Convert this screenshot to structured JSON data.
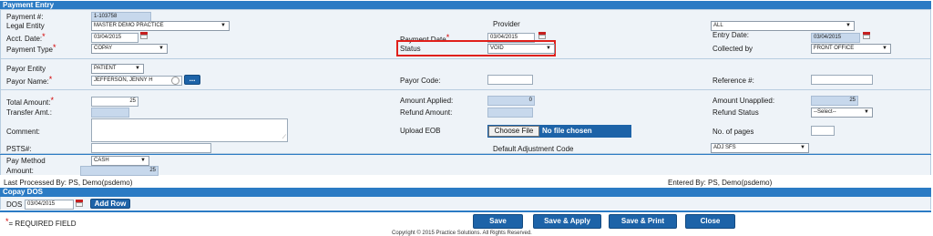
{
  "payment_entry": {
    "section_title": "Payment Entry",
    "payment_number_label": "Payment #:",
    "payment_number_value": "1-103758",
    "legal_entity_label": "Legal Entity",
    "legal_entity_value": "MASTER DEMO PRACTICE",
    "provider_label": "Provider",
    "provider_value": "ALL",
    "acct_date_label": "Acct. Date:",
    "acct_date_value": "03/04/2015",
    "payment_date_label": "Payment Date",
    "payment_date_value": "03/04/2015",
    "entry_date_label": "Entry Date:",
    "entry_date_value": "03/04/2015",
    "payment_type_label": "Payment Type",
    "payment_type_value": "COPAY",
    "status_label": "Status",
    "status_value": "VOID",
    "collected_by_label": "Collected by",
    "collected_by_value": "FRONT OFFICE",
    "payor_entity_label": "Payor Entity",
    "payor_entity_value": "PATIENT",
    "payor_name_label": "Payor Name:",
    "payor_name_value": "JEFFERSON, JENNY H",
    "payor_search_button": "...",
    "payor_code_label": "Payor Code:",
    "payor_code_value": "",
    "reference_label": "Reference #:",
    "reference_value": "",
    "total_amount_label": "Total Amount:",
    "total_amount_value": "25",
    "amount_applied_label": "Amount Applied:",
    "amount_applied_value": "0",
    "amount_unapplied_label": "Amount Unapplied:",
    "amount_unapplied_value": "25",
    "transfer_amt_label": "Transfer Amt.:",
    "transfer_amt_value": "",
    "refund_amount_label": "Refund Amount:",
    "refund_amount_value": "",
    "refund_status_label": "Refund Status",
    "refund_status_value": "--Select--",
    "comment_label": "Comment:",
    "comment_value": "",
    "upload_eob_label": "Upload EOB",
    "choose_file_button": "Choose File",
    "no_file_text": "No file chosen",
    "no_of_pages_label": "No. of pages",
    "no_of_pages_value": "",
    "psts_label": "PSTS#:",
    "psts_value": "",
    "default_adjustment_label": "Default Adjustment Code",
    "default_adjustment_value": "ADJ SFS"
  },
  "pay_method": {
    "pay_method_label": "Pay Method",
    "pay_method_value": "CASH",
    "amount_label": "Amount:",
    "amount_value": "25"
  },
  "audit": {
    "last_processed": "Last Processed By: PS, Demo(psdemo)",
    "entered_by": "Entered By: PS, Demo(psdemo)"
  },
  "copay_dos": {
    "section_title": "Copay DOS",
    "dos_label": "DOS",
    "dos_value": "03/04/2015",
    "add_row_button": "Add Row"
  },
  "footer": {
    "required_star": "*",
    "required_text": "= REQUIRED FIELD",
    "save_button": "Save",
    "save_apply_button": "Save & Apply",
    "save_print_button": "Save & Print",
    "close_button": "Close",
    "copyright": "Copyright © 2015 Practice Solutions. All Rights Reserved."
  },
  "colors": {
    "header_blue": "#2b7bc4",
    "button_blue": "#1d63a8",
    "required_red": "#d40000",
    "highlight_red": "#e0201b",
    "readonly_fill": "#c7d8ec"
  },
  "icons": [
    "calendar-icon",
    "dropdown-arrow-icon",
    "clear-search-icon",
    "textarea-resize-icon"
  ]
}
